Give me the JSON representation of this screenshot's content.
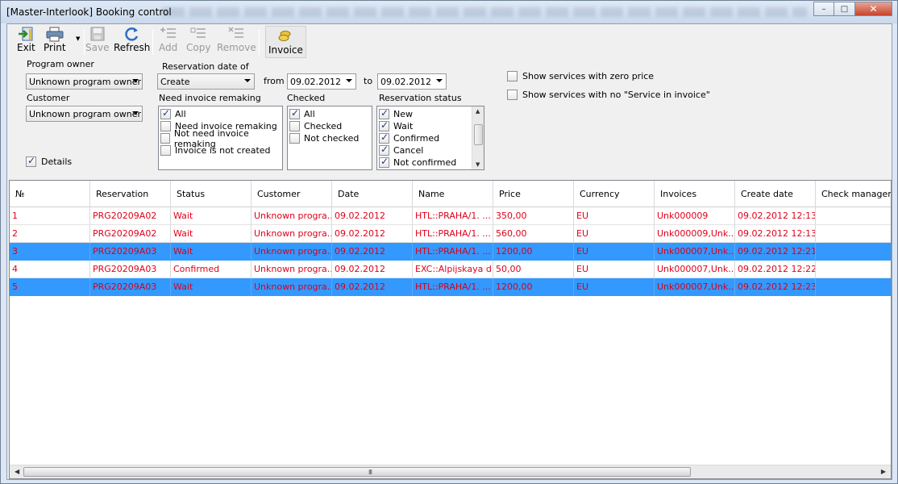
{
  "window": {
    "title": "[Master-Interlook] Booking control",
    "controls": {
      "minimize": "–",
      "maximize": "□",
      "close": "✕"
    }
  },
  "toolbar": {
    "exit": "Exit",
    "print": "Print",
    "save": "Save",
    "refresh": "Refresh",
    "add": "Add",
    "copy": "Copy",
    "remove": "Remove",
    "invoice": "Invoice"
  },
  "filters": {
    "program_owner_label": "Program owner",
    "program_owner_value": "Unknown program owner",
    "customer_label": "Customer",
    "customer_value": "Unknown program owner",
    "details_label": "Details",
    "reservation_date_label": "Reservation date of",
    "reservation_date_value": "Create",
    "from_label": "from",
    "from_value": "09.02.2012",
    "to_label": "to",
    "to_value": "09.02.2012",
    "need_invoice_label": "Need invoice remaking",
    "need_invoice_items": [
      {
        "label": "All",
        "checked": true
      },
      {
        "label": "Need invoice remaking",
        "checked": false
      },
      {
        "label": "Not need invoice remaking",
        "checked": false
      },
      {
        "label": "Invoice is not created",
        "checked": false
      }
    ],
    "checked_label": "Checked",
    "checked_items": [
      {
        "label": "All",
        "checked": true
      },
      {
        "label": "Checked",
        "checked": false
      },
      {
        "label": "Not checked",
        "checked": false
      }
    ],
    "reservation_status_label": "Reservation status",
    "reservation_status_items": [
      {
        "label": "New",
        "checked": true
      },
      {
        "label": "Wait",
        "checked": true
      },
      {
        "label": "Confirmed",
        "checked": true
      },
      {
        "label": "Cancel",
        "checked": true
      },
      {
        "label": "Not confirmed",
        "checked": true
      }
    ],
    "show_zero_price": "Show services with zero price",
    "show_no_service": "Show services with no \"Service in invoice\""
  },
  "grid": {
    "columns": [
      "№",
      "Reservation",
      "Status",
      "Customer",
      "Date",
      "Name",
      "Price",
      "Currency",
      "Invoices",
      "Create date",
      "Check manager"
    ],
    "rows": [
      {
        "selected": false,
        "cells": [
          "1",
          "PRG20209A02",
          "Wait",
          "Unknown progra...",
          "09.02.2012",
          "HTL::PRAHA/1. ...",
          "350,00",
          "EU",
          "Unk000009",
          "09.02.2012 12:13",
          ""
        ]
      },
      {
        "selected": false,
        "cells": [
          "2",
          "PRG20209A02",
          "Wait",
          "Unknown progra...",
          "09.02.2012",
          "HTL::PRAHA/1. ...",
          "560,00",
          "EU",
          "Unk000009,Unk...",
          "09.02.2012 12:13",
          ""
        ]
      },
      {
        "selected": true,
        "cells": [
          "3",
          "PRG20209A03",
          "Wait",
          "Unknown progra...",
          "09.02.2012",
          "HTL::PRAHA/1. ...",
          "1200,00",
          "EU",
          "Unk000007,Unk...",
          "09.02.2012 12:21",
          ""
        ]
      },
      {
        "selected": false,
        "cells": [
          "4",
          "PRG20209A03",
          "Confirmed",
          "Unknown progra...",
          "09.02.2012",
          "EXC::Alpijskaya d...",
          "50,00",
          "EU",
          "Unk000007,Unk...",
          "09.02.2012 12:22",
          ""
        ]
      },
      {
        "selected": true,
        "cells": [
          "5",
          "PRG20209A03",
          "Wait",
          "Unknown progra...",
          "09.02.2012",
          "HTL::PRAHA/1. ...",
          "1200,00",
          "EU",
          "Unk000007,Unk...",
          "09.02.2012 12:23",
          ""
        ]
      }
    ],
    "scroll_grip": "III"
  }
}
